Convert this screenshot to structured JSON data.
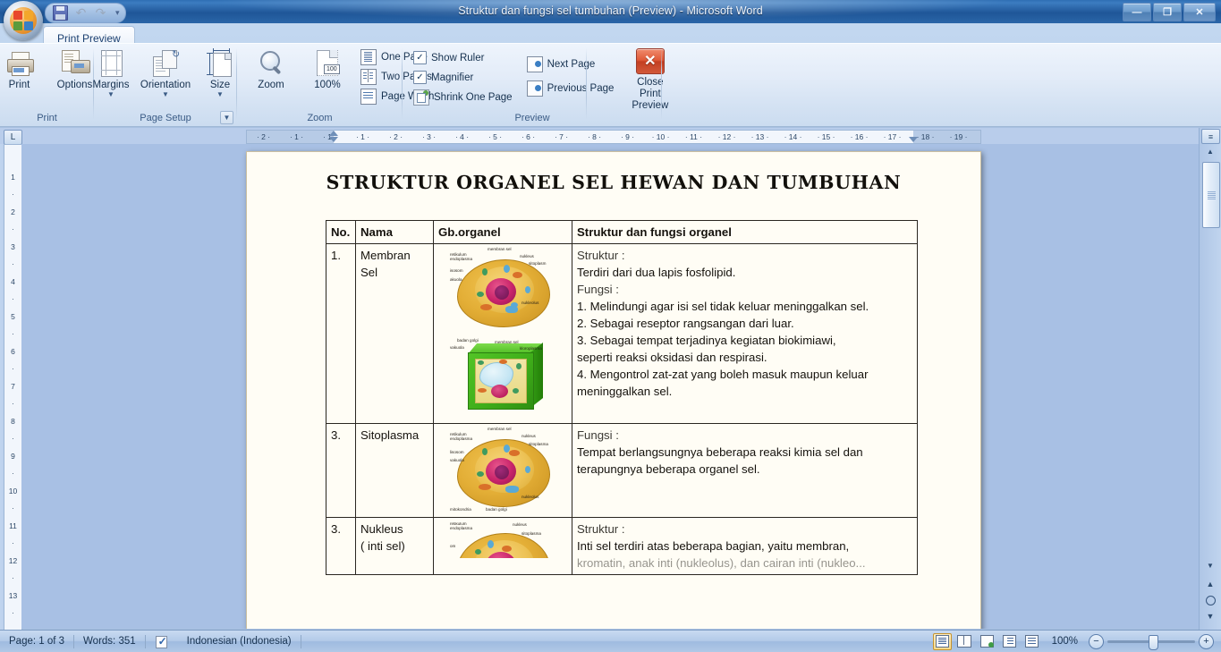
{
  "window": {
    "title": "Struktur dan fungsi sel tumbuhan (Preview) - Microsoft Word",
    "minimize": "—",
    "restore": "❐",
    "close": "✕"
  },
  "quick_access": {
    "save": "save-icon",
    "undo": "↶",
    "redo": "↷",
    "customize": "▾"
  },
  "tabs": [
    {
      "label": "Print Preview",
      "active": true
    }
  ],
  "ribbon": {
    "groups": [
      {
        "name": "Print",
        "label": "Print",
        "buttons": [
          {
            "label": "Print",
            "icon": "printer-icon"
          },
          {
            "label": "Options",
            "icon": "options-icon"
          }
        ]
      },
      {
        "name": "Page Setup",
        "label": "Page Setup",
        "buttons": [
          {
            "label": "Margins",
            "icon": "margins-icon",
            "caret": "▼"
          },
          {
            "label": "Orientation",
            "icon": "orientation-icon",
            "caret": "▼"
          },
          {
            "label": "Size",
            "icon": "size-icon",
            "caret": "▼"
          }
        ],
        "dialog_launcher": "▼"
      },
      {
        "name": "Zoom",
        "label": "Zoom",
        "buttons": [
          {
            "label": "Zoom",
            "icon": "magnifier-icon"
          },
          {
            "label": "100%",
            "icon": "one-hundred-percent-icon"
          }
        ],
        "small_buttons": [
          {
            "label": "One Page",
            "icon": "one-page-icon"
          },
          {
            "label": "Two Pages",
            "icon": "two-pages-icon"
          },
          {
            "label": "Page Width",
            "icon": "page-width-icon"
          }
        ]
      },
      {
        "name": "Preview",
        "label": "Preview",
        "checkboxes": [
          {
            "label": "Show Ruler",
            "checked": true
          },
          {
            "label": "Magnifier",
            "checked": true
          }
        ],
        "small_buttons": [
          {
            "label": "Shrink One Page",
            "icon": "shrink-one-page-icon"
          },
          {
            "label": "Next Page",
            "icon": "next-page-icon"
          },
          {
            "label": "Previous Page",
            "icon": "previous-page-icon"
          }
        ],
        "close_button": {
          "label": "Close Print\nPreview",
          "line1": "Close Print",
          "line2": "Preview",
          "glyph": "✕"
        }
      }
    ]
  },
  "rulers": {
    "corner_tab_marker": "L",
    "horizontal_ticks": [
      "2",
      "1",
      "1",
      "1",
      "2",
      "3",
      "4",
      "5",
      "6",
      "7",
      "8",
      "9",
      "10",
      "11",
      "12",
      "13",
      "14",
      "15",
      "16",
      "17",
      "18",
      "19"
    ],
    "vertical_ticks": [
      "1",
      "2",
      "3",
      "4",
      "5",
      "6",
      "7",
      "8",
      "9",
      "10",
      "11",
      "12",
      "13"
    ]
  },
  "document": {
    "title": "STRUKTUR ORGANEL SEL HEWAN DAN TUMBUHAN",
    "table": {
      "headers": [
        "No.",
        "Nama",
        "Gb.organel",
        "Struktur dan fungsi organel"
      ],
      "rows": [
        {
          "no": "1.",
          "nama": "Membran Sel",
          "nama_line1": "Membran",
          "nama_line2": "Sel",
          "diagram": "animal-and-plant-cell-diagram",
          "content_lines": [
            "Struktur :",
            "Terdiri dari dua lapis fosfolipid.",
            "Fungsi :",
            "1. Melindungi agar isi sel tidak keluar meninggalkan sel.",
            "2. Sebagai reseptor rangsangan dari luar.",
            "3. Sebagai tempat terjadinya kegiatan biokimiawi,",
            "seperti reaksi oksidasi dan respirasi.",
            "4. Mengontrol zat-zat yang boleh masuk maupun keluar",
            "meninggalkan sel."
          ]
        },
        {
          "no": "3.",
          "nama": "Sitoplasma",
          "nama_line1": "Sitoplasma",
          "nama_line2": "",
          "diagram": "animal-cell-diagram",
          "content_lines": [
            "Fungsi :",
            "Tempat berlangsungnya beberapa reaksi kimia sel dan",
            "terapungnya beberapa organel sel."
          ]
        },
        {
          "no": "3.",
          "nama": "Nukleus ( inti sel)",
          "nama_line1": "Nukleus",
          "nama_line2": "( inti sel)",
          "diagram": "animal-cell-diagram",
          "content_lines": [
            "Struktur :",
            "Inti sel terdiri atas beberapa bagian, yaitu membran,",
            "kromatin, anak inti (nukleolus), dan cairan inti (nukleo..."
          ]
        }
      ]
    },
    "diagram_labels": {
      "animal": [
        "membran sel",
        "nukleus",
        "sitoplasm",
        "retikulum endoplasma",
        "isosom",
        "akuola",
        "nukleolus"
      ],
      "animal2": [
        "membran sel",
        "nukleus",
        "sitoplasma",
        "retikulum endoplasma",
        "lisosom",
        "vakuola",
        "nukleolus",
        "mitokondria",
        "badan golgi"
      ],
      "plant": [
        "badan golgi",
        "membran sel",
        "vakuola",
        "kloroplasma"
      ]
    }
  },
  "status_bar": {
    "page": "Page: 1 of 3",
    "words": "Words: 351",
    "language": "Indonesian (Indonesia)",
    "spell_icon": "spell-check-icon",
    "views": [
      {
        "name": "print-layout",
        "active": true
      },
      {
        "name": "full-screen-reading",
        "active": false
      },
      {
        "name": "web-layout",
        "active": false
      },
      {
        "name": "outline",
        "active": false
      },
      {
        "name": "draft",
        "active": false
      }
    ],
    "zoom_level": "100%",
    "zoom_out": "−",
    "zoom_in": "+"
  },
  "scrollbar": {
    "split": "≡",
    "up_arrow": "▲",
    "down_arrow": "▼",
    "previous_object": "▲",
    "select_browse_object": "◉",
    "next_object": "▼"
  }
}
